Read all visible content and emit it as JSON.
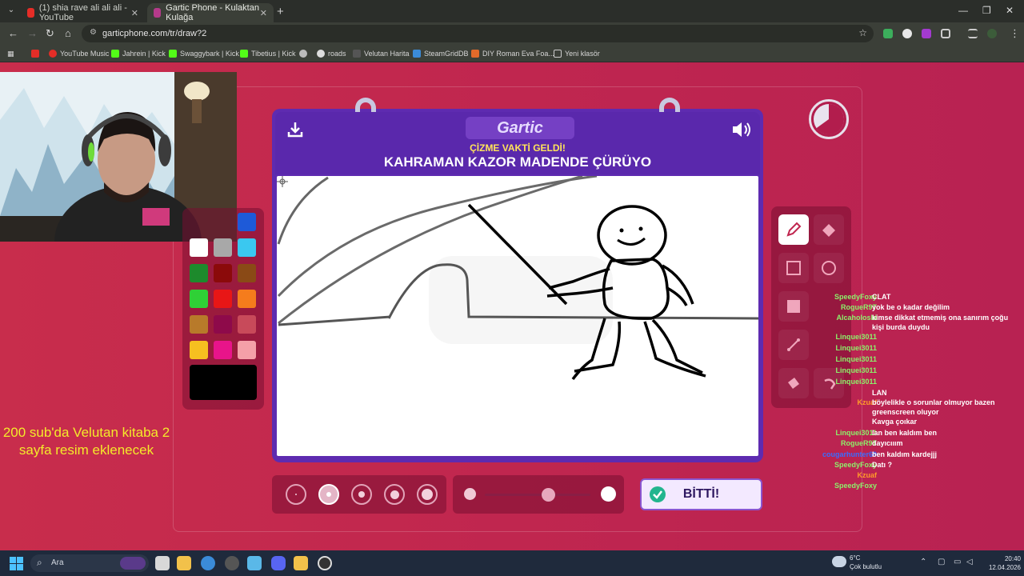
{
  "browser": {
    "tabs": [
      {
        "title": "(1) shia rave ali ali ali - YouTube",
        "active": false
      },
      {
        "title": "Gartic Phone - Kulaktan Kulağa",
        "active": true
      }
    ],
    "url": "garticphone.com/tr/draw?2",
    "bookmarks": [
      "YouTube Music",
      "Jahrein | Kick",
      "Swaggybark | Kick",
      "Tibetius | Kick",
      "roads",
      "Velutan Harita",
      "SteamGridDB",
      "DIY Roman Eva Foa...",
      "Yeni klasör"
    ]
  },
  "game": {
    "logo": "Gartic",
    "prompt_subtitle": "ÇİZME VAKTİ GELDİ!",
    "prompt_title": "KAHRAMAN KAZOR MADENDE ÇÜRÜYO",
    "done_label": "BİTTİ!",
    "timer_remaining_fraction": 0.65,
    "opacity_value": 0.6,
    "selected_brush_size_index": 1,
    "selected_color": "#000000",
    "palette": [
      "#1e5ad8",
      "#ffffff",
      "#a8a8a8",
      "#3ac8f0",
      "#1d8a2c",
      "#8b0a0a",
      "#8a4a16",
      "#2fd036",
      "#e81616",
      "#f57c1c",
      "#b87a2a",
      "#8e0a4a",
      "#c84a5a",
      "#f6c020",
      "#e8148a",
      "#f4a0a8"
    ],
    "tools": [
      "pencil-icon",
      "eraser-icon",
      "square-icon",
      "circle-icon",
      "fill-square-icon",
      "line-icon",
      "fill-bucket-icon",
      "undo-icon"
    ]
  },
  "overlay_note": "200 sub'da Velutan kitaba 2 sayfa resim eklenecek",
  "chat": [
    {
      "user": "SpeedyFoxy",
      "color": "#8cf26a",
      "text": "CLAT"
    },
    {
      "user": "RogueR9T",
      "color": "#8cf26a",
      "text": "yok be o kadar değilim"
    },
    {
      "user": "Alcaholoski",
      "color": "#8cf26a",
      "text": "kimse dikkat etmemiş ona sanırım çoğu kişi burda duydu"
    },
    {
      "user": "Linquei3011",
      "color": "#8cf26a",
      "text": ""
    },
    {
      "user": "Linquei3011",
      "color": "#8cf26a",
      "text": ""
    },
    {
      "user": "Linquei3011",
      "color": "#8cf26a",
      "text": ""
    },
    {
      "user": "Linquei3011",
      "color": "#8cf26a",
      "text": ""
    },
    {
      "user": "Linquei3011",
      "color": "#8cf26a",
      "text": ""
    },
    {
      "user": "",
      "color": "#c0264f",
      "text": "LAN"
    },
    {
      "user": "Kzuaf",
      "color": "#ff9a2a",
      "text": "böylelikle o sorunlar olmuyor bazen greenscreen oluyor"
    },
    {
      "user": "",
      "color": "#c0264f",
      "text": "Kavga çoıkar"
    },
    {
      "user": "Linquei3011",
      "color": "#8cf26a",
      "text": "lan ben kaldım ben"
    },
    {
      "user": "RogueR9T",
      "color": "#8cf26a",
      "text": "dayıcııım"
    },
    {
      "user": "cougarhunter69",
      "color": "#3a6cff",
      "text": "ben kaldım kardejjj"
    },
    {
      "user": "SpeedyFoxy",
      "color": "#8cf26a",
      "text": "Datı ?"
    },
    {
      "user": "Kzuaf",
      "color": "#ff9a2a",
      "text": ""
    },
    {
      "user": "SpeedyFoxy",
      "color": "#8cf26a",
      "text": ""
    }
  ],
  "taskbar": {
    "search_label": "Ara",
    "weather_temp": "6°C",
    "weather_desc": "Çok bulutlu",
    "time": "20:40",
    "date": "12.04.2026"
  }
}
